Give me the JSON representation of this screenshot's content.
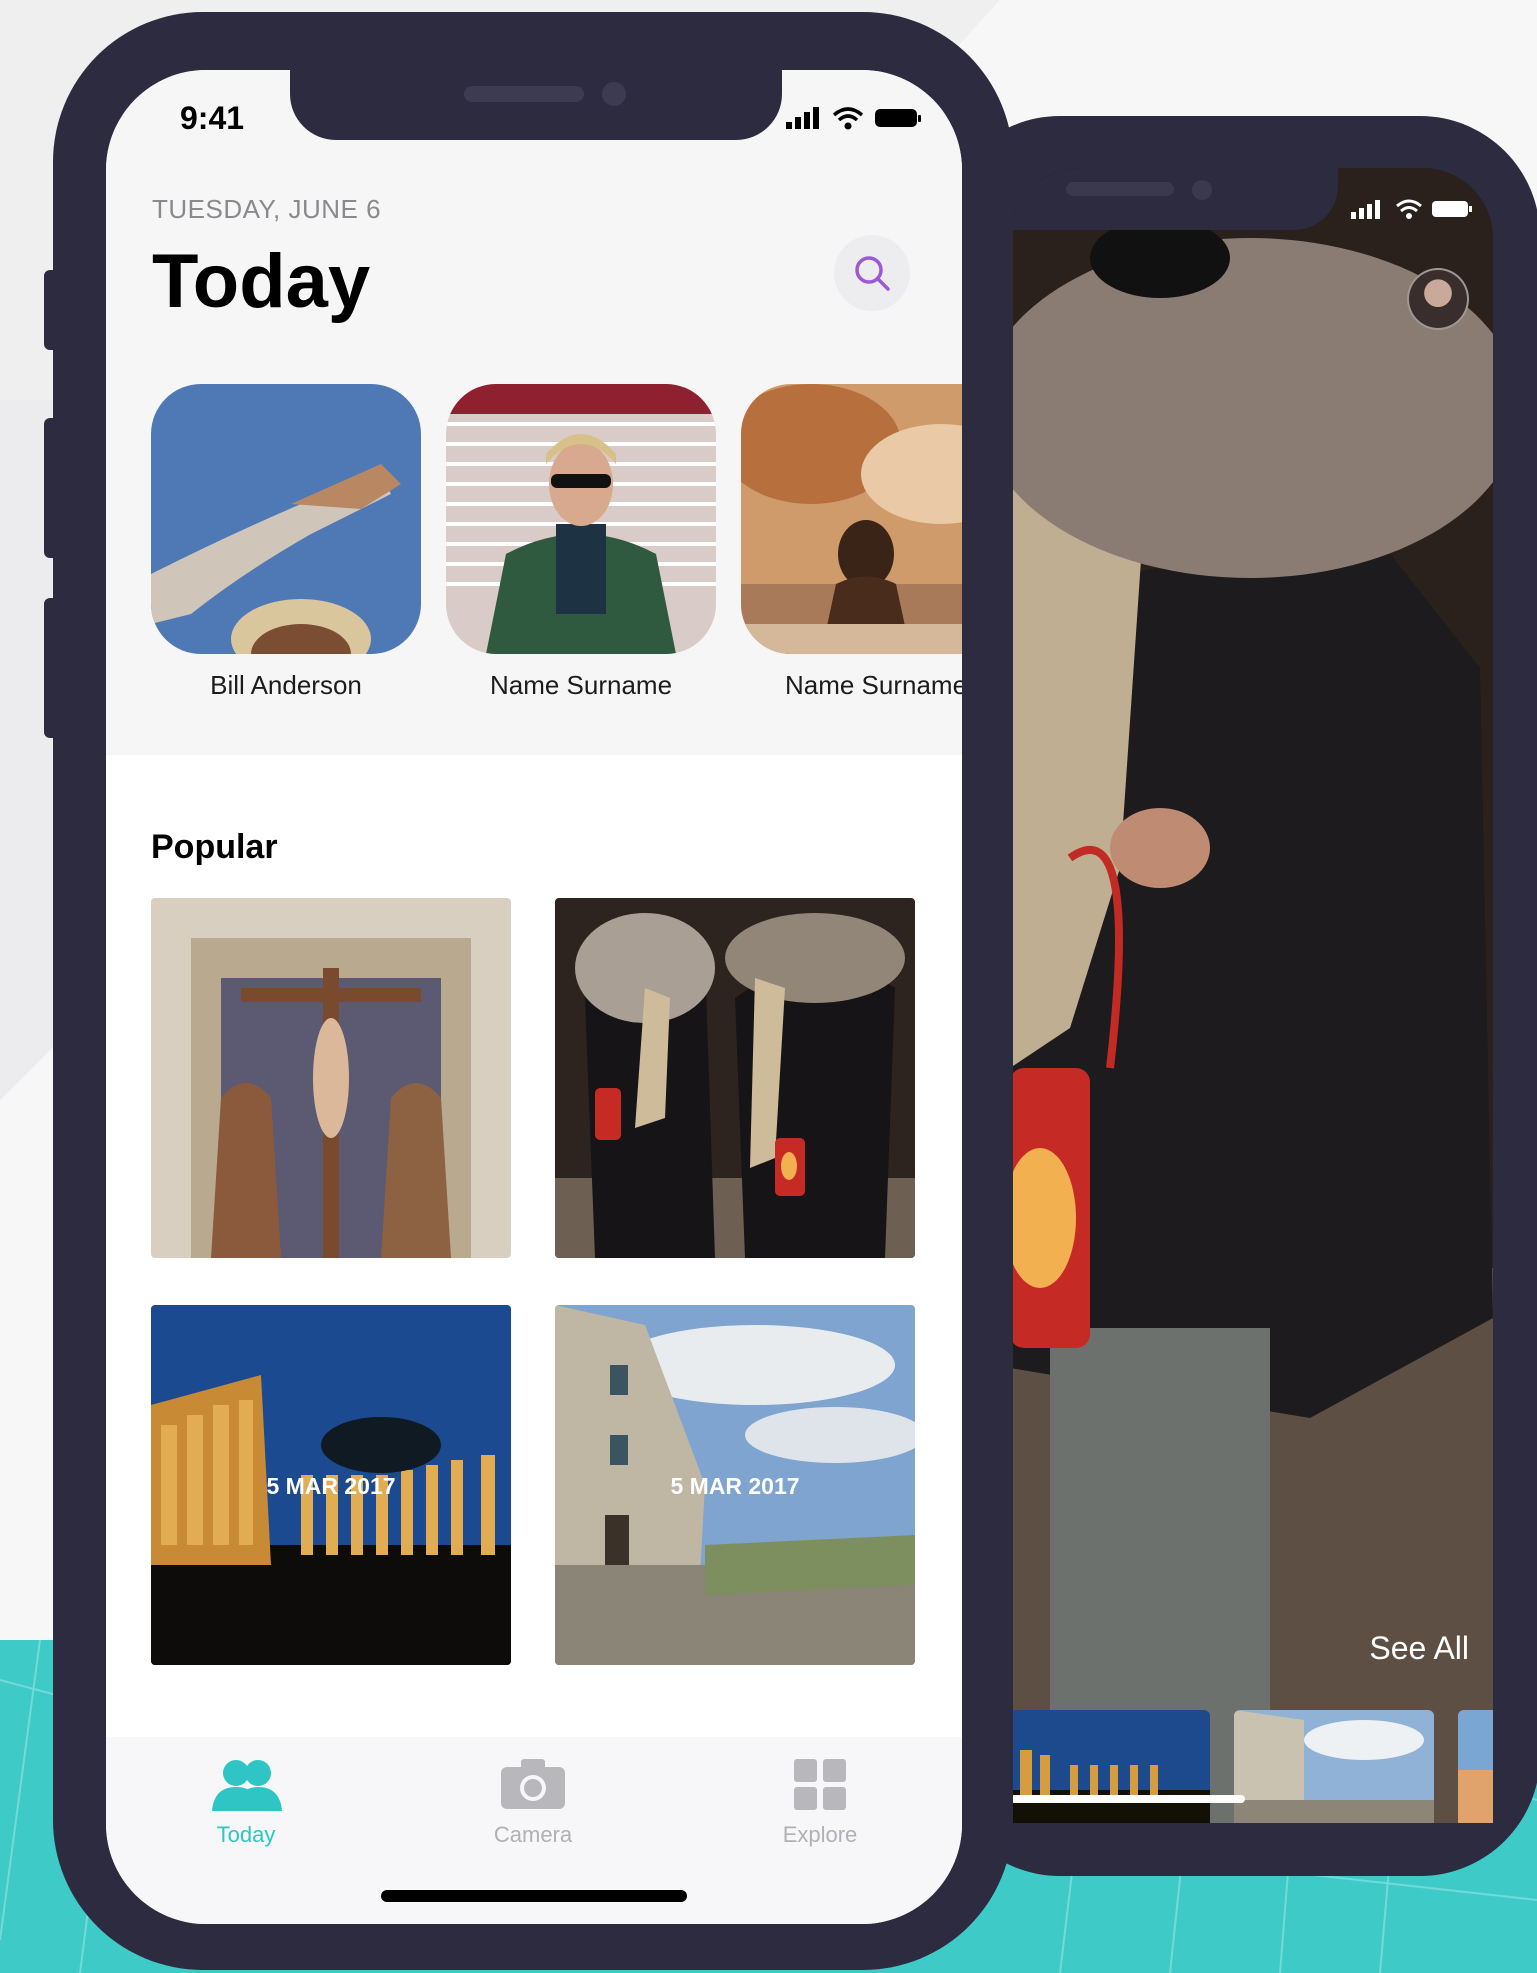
{
  "front": {
    "status_time": "9:41",
    "date": "TUESDAY, JUNE 6",
    "title": "Today",
    "search_icon": "search-icon",
    "stories": [
      {
        "name": "Bill Anderson"
      },
      {
        "name": "Name Surname"
      },
      {
        "name": "Name Surname"
      }
    ],
    "popular_title": "Popular",
    "tiles": [
      {
        "label": ""
      },
      {
        "label": ""
      },
      {
        "label": "5 MAR 2017"
      },
      {
        "label": "5 MAR 2017"
      }
    ],
    "tabs": [
      {
        "label": "Today",
        "icon": "people-icon",
        "active": true
      },
      {
        "label": "Camera",
        "icon": "camera-icon",
        "active": false
      },
      {
        "label": "Explore",
        "icon": "grid-icon",
        "active": false
      }
    ]
  },
  "back": {
    "see_all": "See All",
    "progress": 0.5
  },
  "colors": {
    "accent_teal": "#2ec5c4",
    "accent_purple": "#9b59d6",
    "phone_frame": "#2c2b40",
    "background": "#efeff0"
  }
}
